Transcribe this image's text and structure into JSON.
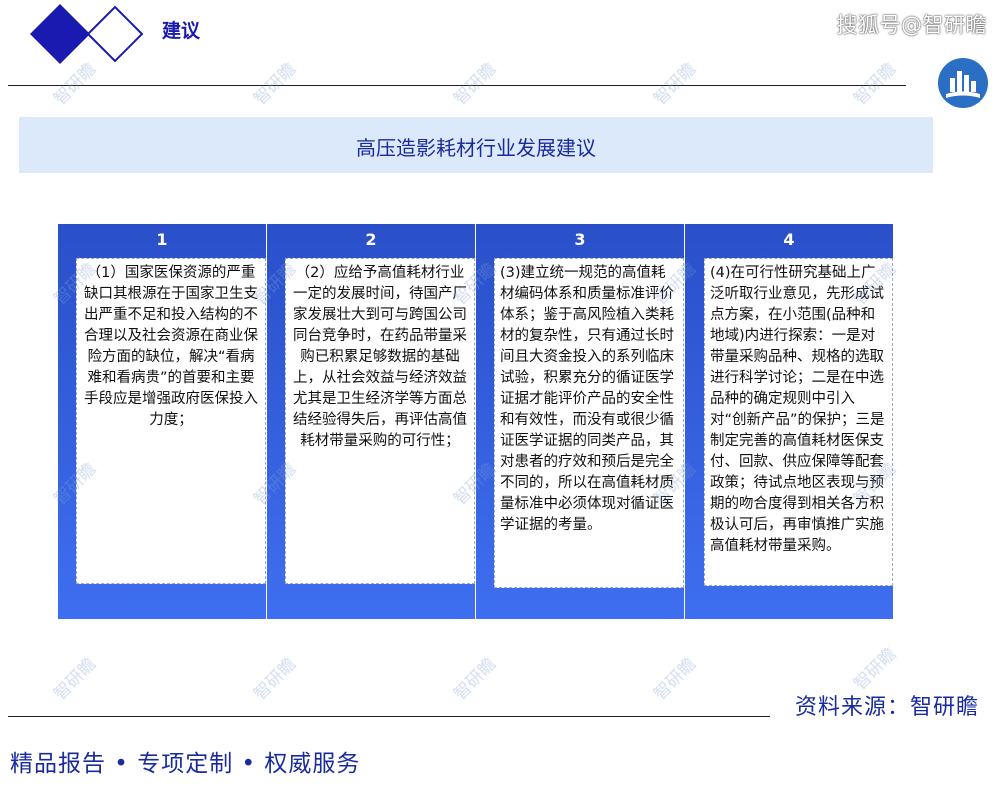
{
  "header": {
    "title": "建议",
    "platform_tag": "搜狐号@智研瞻"
  },
  "banner": {
    "title": "高压造影耗材行业发展建议"
  },
  "columns": [
    {
      "number": "1",
      "text": "（1）国家医保资源的严重缺口其根源在于国家卫生支出严重不足和投入结构的不合理以及社会资源在商业保险方面的缺位，解决“看病难和看病贵”的首要和主要手段应是增强政府医保投入力度；"
    },
    {
      "number": "2",
      "text": "（2）应给予高值耗材行业一定的发展时间，待国产厂家发展壮大到可与跨国公司同台竞争时，在药品带量采购已积累足够数据的基础上，从社会效益与经济效益尤其是卫生经济学等方面总结经验得失后，再评估高值耗材带量采购的可行性；"
    },
    {
      "number": "3",
      "text": "(3)建立统一规范的高值耗材编码体系和质量标准评价体系；鉴于高风险植入类耗材的复杂性，只有通过长时间且大资金投入的系列临床试验，积累充分的循证医学证据才能评价产品的安全性和有效性，而没有或很少循证医学证据的同类产品，其对患者的疗效和预后是完全不同的，所以在高值耗材质量标准中必须体现对循证医学证据的考量。"
    },
    {
      "number": "4",
      "text": "(4)在可行性研究基础上广泛听取行业意见，先形成试点方案，在小范围(品种和地域)内进行探索：一是对带量采购品种、规格的选取进行科学讨论；二是在中选品种的确定规则中引入对“创新产品”的保护；三是制定完善的高值耗材医保支付、回款、供应保障等配套政策；待试点地区表现与预期的吻合度得到相关各方积极认可后，再审慎推广实施高值耗材带量采购。"
    }
  ],
  "watermark": "智研瞻",
  "footer": {
    "source": "资料来源：智研瞻",
    "tagline": "精品报告 •  专项定制 • 权威服务"
  },
  "colors": {
    "brand_blue": "#1a2b9e",
    "panel_blue": "#3564e0",
    "banner_bg": "#dce9fb"
  }
}
